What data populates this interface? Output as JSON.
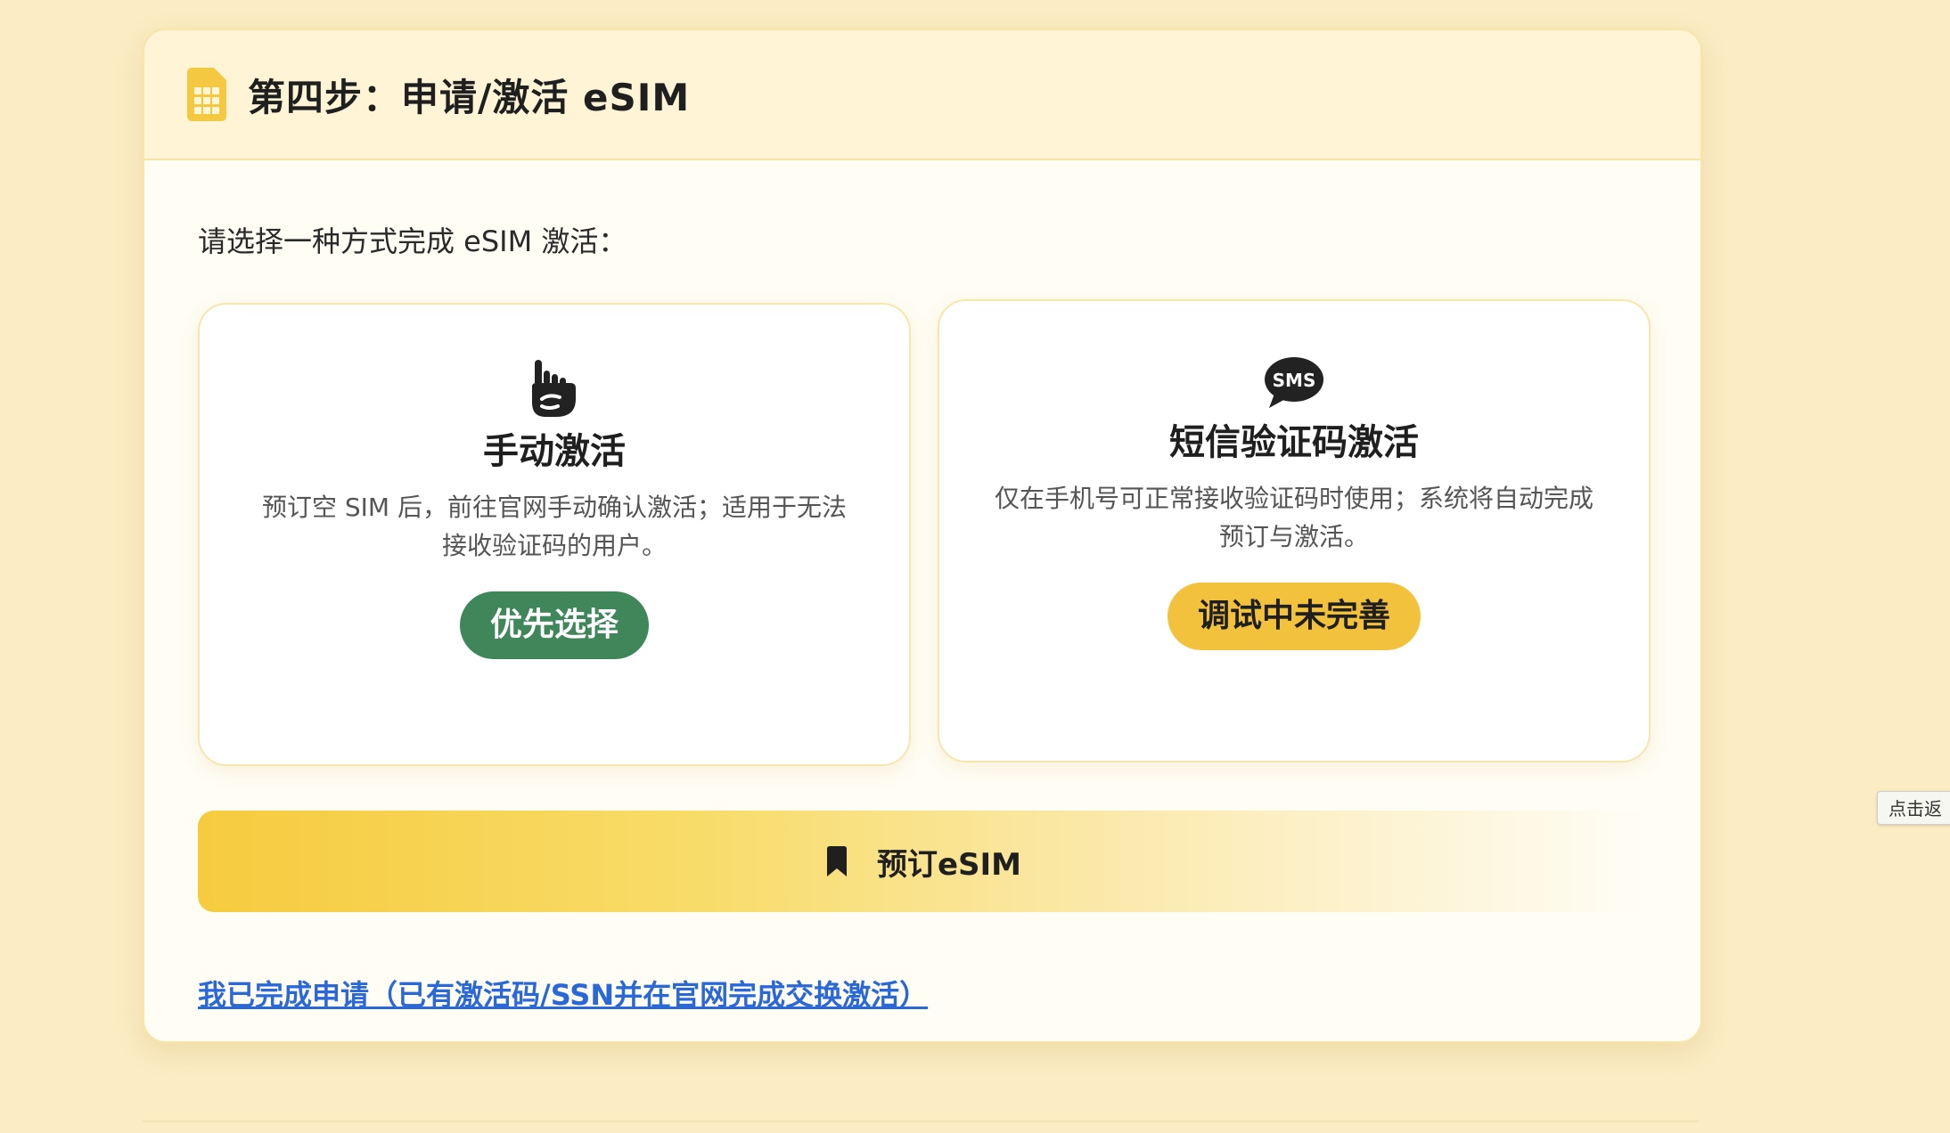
{
  "step": {
    "title": "第四步：申请/激活 eSIM",
    "icon": "sim-card-icon"
  },
  "intro": "请选择一种方式完成 eSIM 激活：",
  "options": [
    {
      "icon": "hand-pointer-icon",
      "title": "手动激活",
      "description": "预订空 SIM 后，前往官网手动确认激活；适用于无法接收验证码的用户。",
      "button_label": "优先选择",
      "button_color": "#3f865a"
    },
    {
      "icon": "sms-icon",
      "title": "短信验证码激活",
      "description": "仅在手机号可正常接收验证码时使用；系统将自动完成预订与激活。",
      "button_label": "调试中未完善",
      "button_color": "#f3c23c"
    }
  ],
  "reserve_button": {
    "icon": "bookmark-icon",
    "label": "预订eSIM"
  },
  "done_link": "我已完成申请（已有激活码/SSN并在官网完成交换激活）",
  "side_tab": "点击返",
  "colors": {
    "page_background": "#fbecc4",
    "accent_yellow": "#f6cb3e",
    "link_blue": "#2a68d8"
  }
}
